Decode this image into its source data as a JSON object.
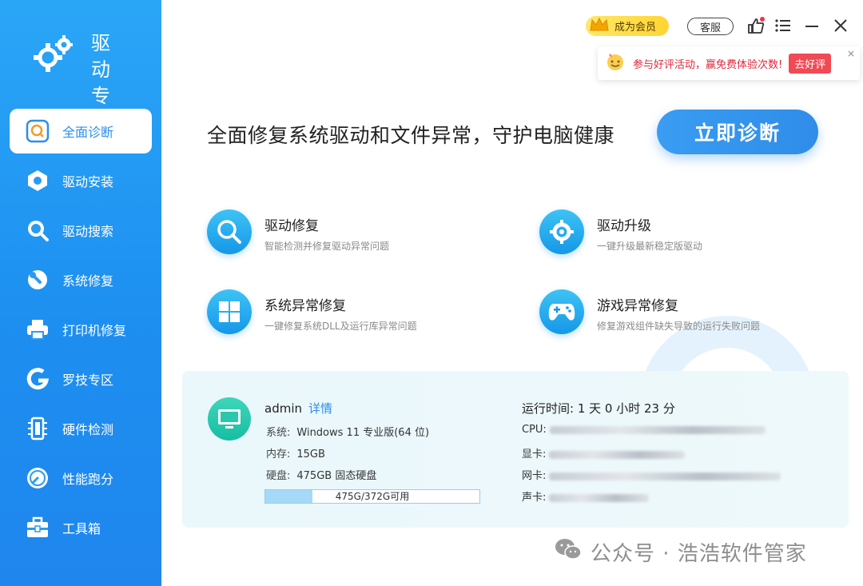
{
  "app": {
    "title_line1": "驱动",
    "title_line2": "专家"
  },
  "sidebar": {
    "items": [
      {
        "label": "全面诊断",
        "icon": "search-icon",
        "active": true
      },
      {
        "label": "驱动安装",
        "icon": "hexagon-icon"
      },
      {
        "label": "驱动搜索",
        "icon": "magnifier-icon"
      },
      {
        "label": "系统修复",
        "icon": "wrench-icon"
      },
      {
        "label": "打印机修复",
        "icon": "printer-icon"
      },
      {
        "label": "罗技专区",
        "icon": "logitech-icon"
      },
      {
        "label": "硬件检测",
        "icon": "chip-icon"
      },
      {
        "label": "性能跑分",
        "icon": "gauge-icon"
      },
      {
        "label": "工具箱",
        "icon": "toolbox-icon"
      }
    ]
  },
  "topbar": {
    "vip_label": "成为会员",
    "service_label": "客服",
    "promo_text": "参与好评活动，赢免费体验次数!",
    "promo_button": "去好评",
    "promo_close": "×"
  },
  "main": {
    "headline": "全面修复系统驱动和文件异常，守护电脑健康",
    "diagnose_button": "立即诊断",
    "features": [
      {
        "title": "驱动修复",
        "desc": "智能检测并修复驱动异常问题",
        "icon": "magnifier-icon"
      },
      {
        "title": "驱动升级",
        "desc": "一键升级最新稳定版驱动",
        "icon": "gear-icon"
      },
      {
        "title": "系统异常修复",
        "desc": "一键修复系统DLL及运行库异常问题",
        "icon": "windows-icon"
      },
      {
        "title": "游戏异常修复",
        "desc": "修复游戏组件缺失导致的运行失败问题",
        "icon": "gamepad-icon"
      }
    ]
  },
  "sysinfo": {
    "username": "admin",
    "details_link": "详情",
    "os_label": "系统:",
    "os_value": "Windows 11 专业版(64 位)",
    "mem_label": "内存:",
    "mem_value": "15GB",
    "disk_label": "硬盘:",
    "disk_value": "475GB 固态硬盘",
    "disk_bar_text": "475G/372G可用",
    "disk_used_fraction": 0.22,
    "uptime_label": "运行时间:",
    "uptime_value": "1 天 0 小时 23 分",
    "cpu_label": "CPU:",
    "gpu_label": "显卡:",
    "net_label": "网卡:",
    "audio_label": "声卡:"
  },
  "watermark": {
    "text": "公众号 · 浩浩软件管家"
  },
  "colors": {
    "sidebar_top": "#2aa6f7",
    "accent": "#2f8de9",
    "promo_red": "#e0253a"
  }
}
